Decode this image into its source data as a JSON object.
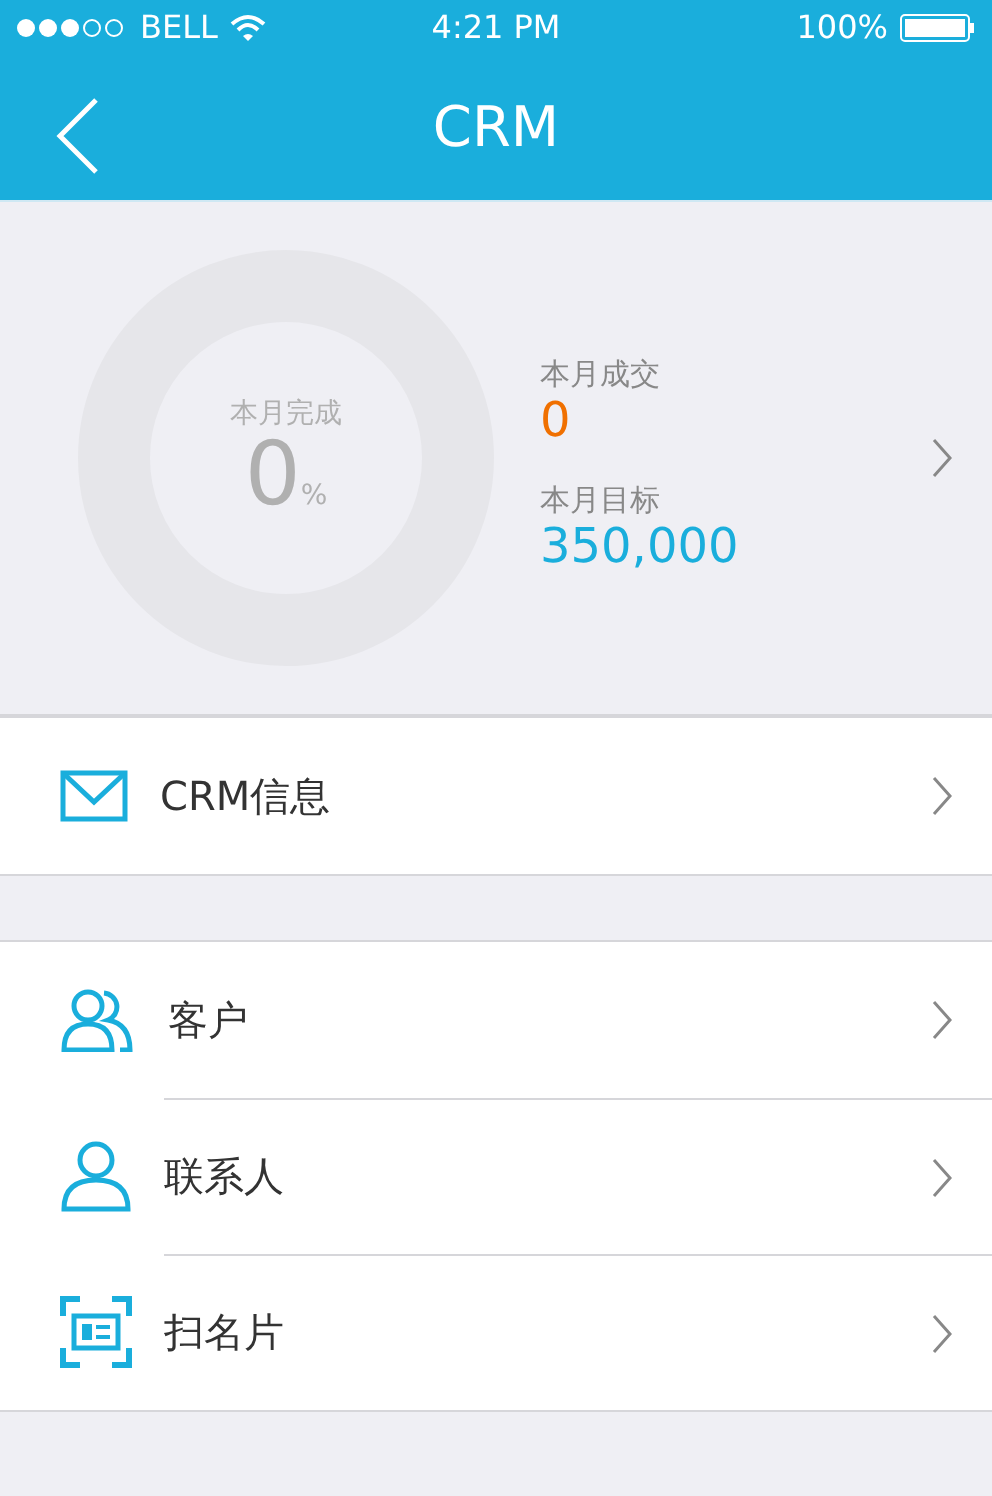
{
  "status_bar": {
    "carrier": "BELL",
    "time": "4:21 PM",
    "battery": "100%"
  },
  "nav": {
    "title": "CRM"
  },
  "summary": {
    "completion_label": "本月完成",
    "completion_value": "0",
    "completion_unit": "%",
    "level": 0,
    "stats": [
      {
        "kind": "deal",
        "label": "本月成交",
        "value": "0"
      },
      {
        "kind": "target",
        "label": "本月目标",
        "value": "350,000"
      }
    ]
  },
  "groups": [
    [
      {
        "kind": "mail",
        "label": "CRM信息"
      }
    ],
    [
      {
        "kind": "people",
        "label": "客户"
      },
      {
        "kind": "person",
        "label": "联系人"
      },
      {
        "kind": "card",
        "label": "扫名片"
      }
    ]
  ]
}
